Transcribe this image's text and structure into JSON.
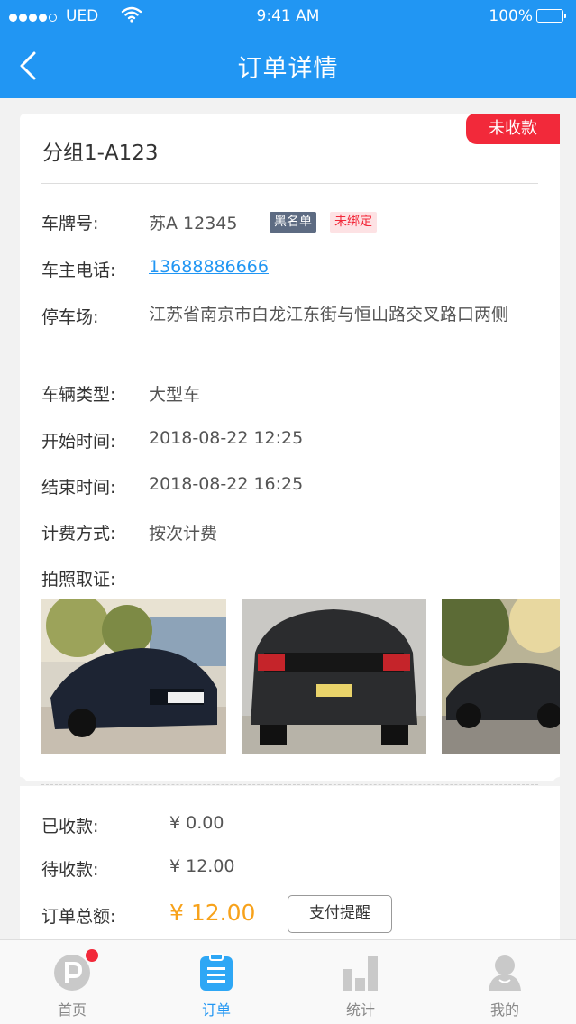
{
  "status_bar": {
    "carrier": "UED",
    "time": "9:41 AM",
    "battery": "100%"
  },
  "header": {
    "title": "订单详情"
  },
  "order": {
    "status_badge": "未收款",
    "group": "分组1-A123",
    "fields": {
      "plate_label": "车牌号:",
      "plate_value": "苏A 12345",
      "tag_blacklist": "黑名单",
      "tag_unbound": "未绑定",
      "phone_label": "车主电话:",
      "phone_value": "13688886666",
      "lot_label": "停车场:",
      "lot_value": "江苏省南京市白龙江东街与恒山路交叉路口两侧",
      "type_label": "车辆类型:",
      "type_value": "大型车",
      "start_label": "开始时间:",
      "start_value": "2018-08-22 12:25",
      "end_label": "结束时间:",
      "end_value": "2018-08-22 16:25",
      "billing_label": "计费方式:",
      "billing_value": "按次计费",
      "photos_label": "拍照取证:"
    },
    "photos": [
      "car-front-photo",
      "car-rear-photo",
      "car-side-photo"
    ]
  },
  "payment": {
    "paid_label": "已收款:",
    "paid_value": "¥ 0.00",
    "pending_label": "待收款:",
    "pending_value": "¥ 12.00",
    "total_label": "订单总额:",
    "total_value": "¥ 12.00",
    "remind_button": "支付提醒"
  },
  "tabbar": {
    "items": [
      {
        "label": "首页",
        "icon": "home-p-icon",
        "badge_dot": true
      },
      {
        "label": "订单",
        "icon": "order-clipboard-icon",
        "active": true
      },
      {
        "label": "统计",
        "icon": "stats-bar-icon"
      },
      {
        "label": "我的",
        "icon": "profile-icon"
      }
    ]
  },
  "colors": {
    "primary": "#2196f3",
    "badge_red": "#f2293a",
    "amount_orange": "#f7a21b"
  }
}
